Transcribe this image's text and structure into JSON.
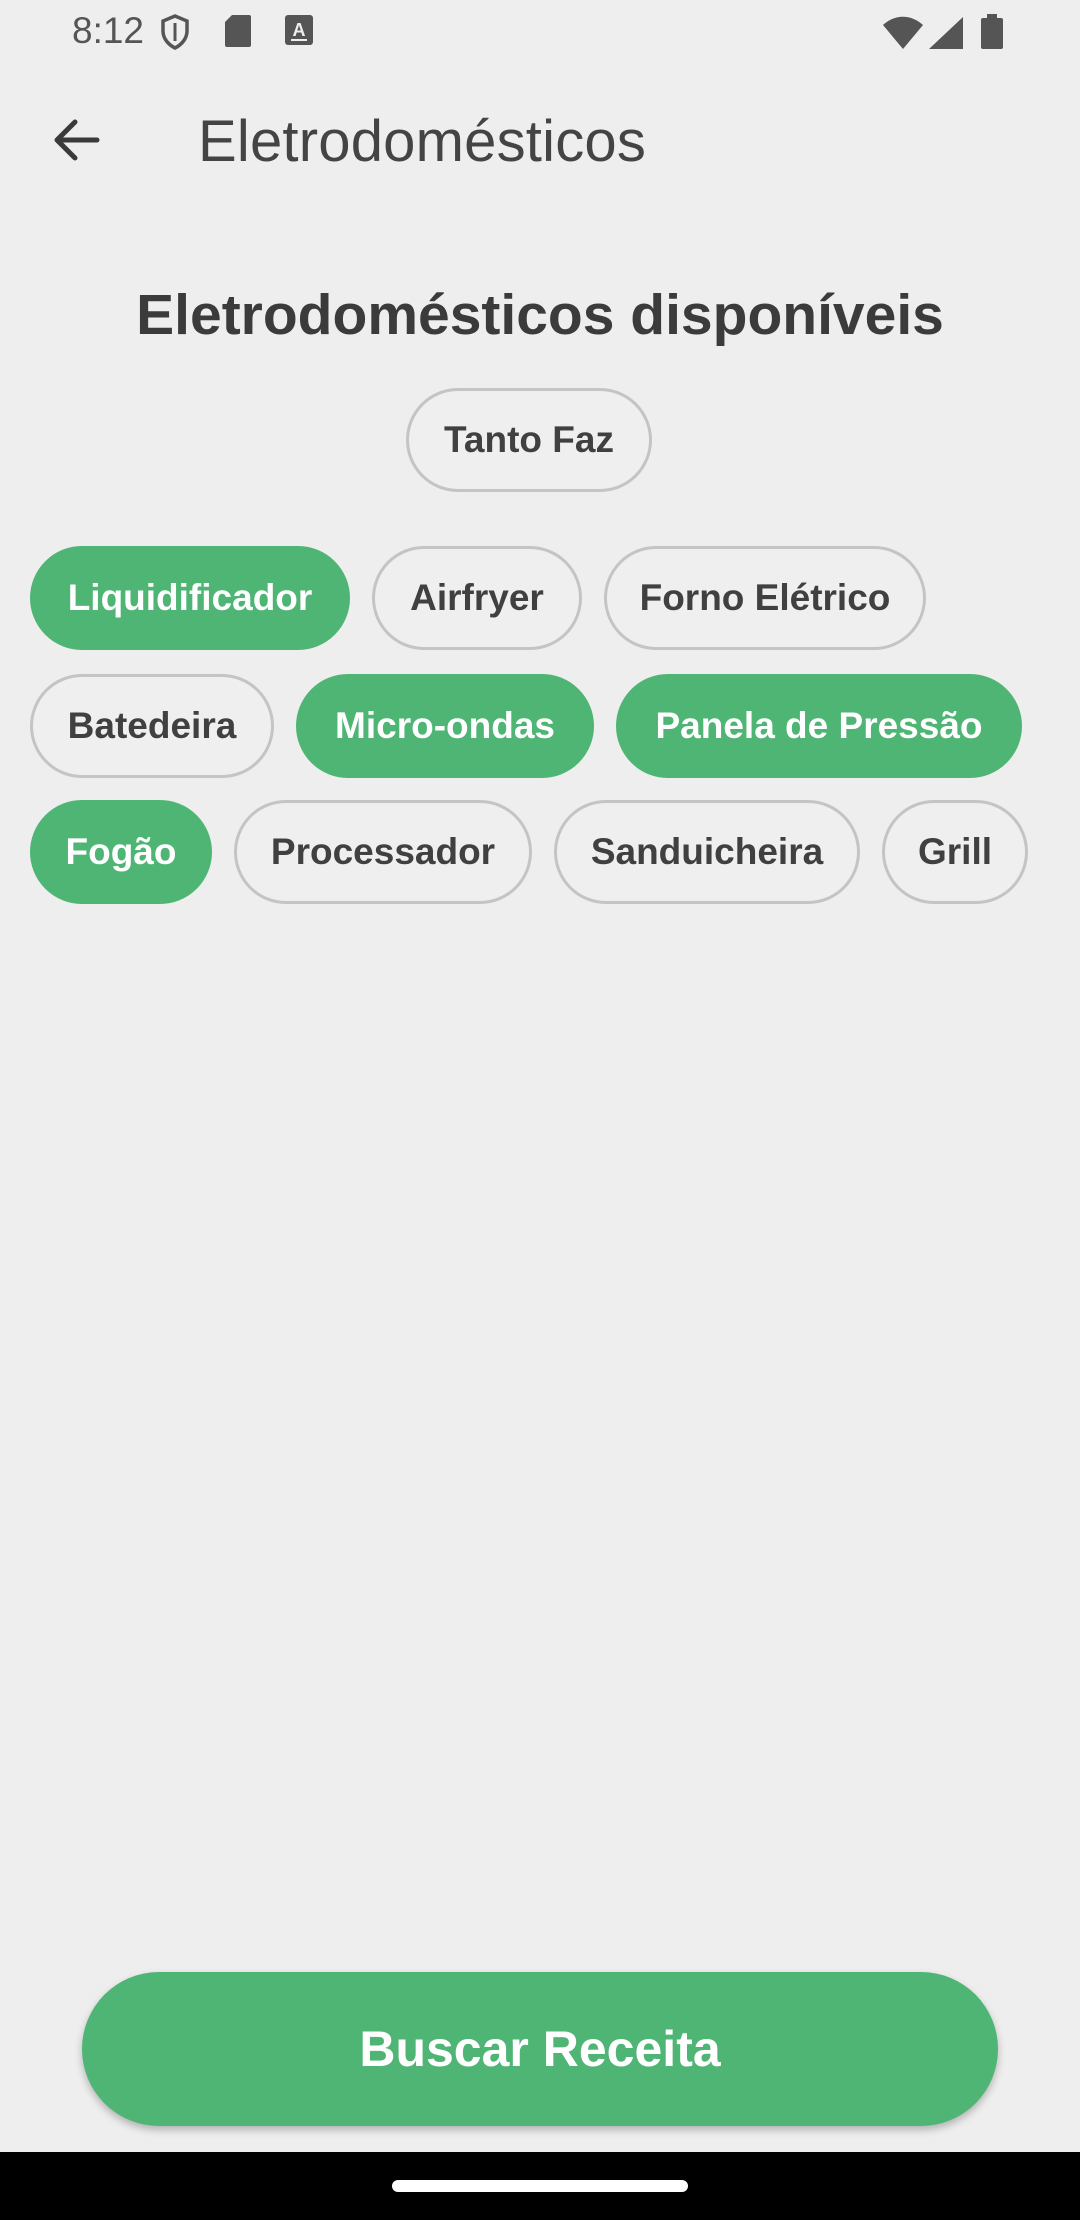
{
  "status_bar": {
    "time": "8:12",
    "icons": [
      "shield-icon",
      "sd-card-icon",
      "keyboard-a-icon",
      "wifi-icon",
      "signal-icon",
      "battery-icon"
    ]
  },
  "app_bar": {
    "back_icon": "arrow-left-icon",
    "title": "Eletrodomésticos"
  },
  "heading": "Eletrodomésticos disponíveis",
  "chips": [
    {
      "label": "Tanto Faz",
      "selected": false
    },
    {
      "label": "Liquidificador",
      "selected": true
    },
    {
      "label": "Airfryer",
      "selected": false
    },
    {
      "label": "Forno Elétrico",
      "selected": false
    },
    {
      "label": "Batedeira",
      "selected": false
    },
    {
      "label": "Micro-ondas",
      "selected": true
    },
    {
      "label": "Panela de Pressão",
      "selected": true
    },
    {
      "label": "Fogão",
      "selected": true
    },
    {
      "label": "Processador",
      "selected": false
    },
    {
      "label": "Sanduicheira",
      "selected": false
    },
    {
      "label": "Grill",
      "selected": false
    }
  ],
  "search_button": {
    "label": "Buscar Receita"
  },
  "colors": {
    "accent": "#4fb574",
    "background": "#eeeeee",
    "chip_border": "#c4c4c4",
    "text": "#3a3a3a"
  }
}
